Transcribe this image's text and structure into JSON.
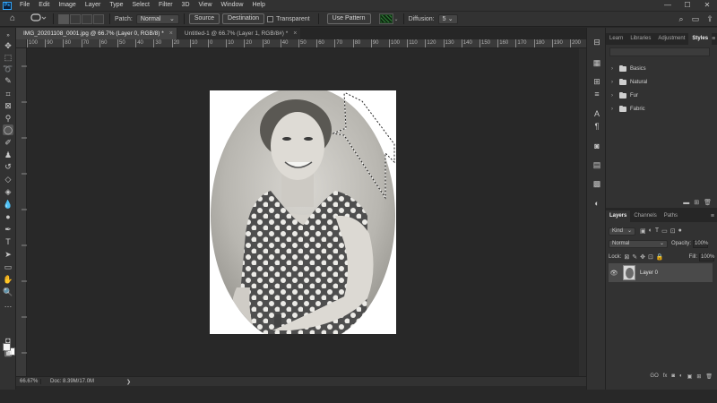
{
  "menu": {
    "app_icon": "Ps",
    "items": [
      "File",
      "Edit",
      "Image",
      "Layer",
      "Type",
      "Select",
      "Filter",
      "3D",
      "View",
      "Window",
      "Help"
    ],
    "window_controls": [
      "—",
      "☐",
      "✕"
    ]
  },
  "options_bar": {
    "patch_label": "Patch:",
    "patch_value": "Normal",
    "source_label": "Source",
    "destination_label": "Destination",
    "transparent_label": "Transparent",
    "transparent_checked": false,
    "use_pattern_label": "Use Pattern",
    "diffusion_label": "Diffusion:",
    "diffusion_value": "5"
  },
  "tabs": [
    {
      "title": "IMG_20201108_0001.jpg @ 66.7% (Layer 0, RGB/8) *",
      "active": true,
      "close": "×"
    },
    {
      "title": "Untitled-1 @ 66.7% (Layer 1, RGB/8#) *",
      "active": false,
      "close": "×"
    }
  ],
  "ruler": {
    "labels": [
      "100",
      "90",
      "80",
      "70",
      "60",
      "50",
      "40",
      "30",
      "20",
      "10",
      "0",
      "10",
      "20",
      "30",
      "40",
      "50",
      "60",
      "70",
      "80",
      "90",
      "100",
      "110",
      "120",
      "130",
      "140",
      "150",
      "160",
      "170",
      "180",
      "190",
      "200"
    ]
  },
  "status": {
    "zoom": "66.67%",
    "doc_info": "Doc: 8.39M/17.0M",
    "arrow": "❯"
  },
  "styles_panel": {
    "tabs": [
      "Learn",
      "Libraries",
      "Adjustment",
      "Styles"
    ],
    "active_tab": "Styles",
    "groups": [
      "Basics",
      "Natural",
      "Fur",
      "Fabric"
    ]
  },
  "layers_panel": {
    "tabs": [
      "Layers",
      "Channels",
      "Paths"
    ],
    "active_tab": "Layers",
    "filter_kind": "Kind",
    "blend_mode": "Normal",
    "opacity_label": "Opacity:",
    "opacity_value": "100%",
    "lock_label": "Lock:",
    "fill_label": "Fill:",
    "fill_value": "100%",
    "layers": [
      {
        "name": "Layer 0",
        "visible": true
      }
    ],
    "footer_icons": [
      "GO",
      "fx",
      "◙",
      "◐",
      "▣",
      "⊞",
      "🗑"
    ]
  },
  "colors": {
    "app_bg": "#323232",
    "canvas_bg": "#282828",
    "accent": "#31a8ff",
    "selected_layer": "#4a4a4a"
  },
  "icons": {
    "toolbar": [
      "move-icon",
      "marquee-icon",
      "lasso-icon",
      "quick-select-icon",
      "crop-icon",
      "frame-icon",
      "eyedropper-icon",
      "patch-tool-icon",
      "brush-icon",
      "clone-stamp-icon",
      "history-brush-icon",
      "eraser-icon",
      "gradient-icon",
      "blur-icon",
      "dodge-icon",
      "pen-icon",
      "type-icon",
      "path-select-icon",
      "rectangle-icon",
      "hand-icon",
      "zoom-icon",
      "more-tools-icon"
    ],
    "right_column": [
      "history-icon",
      "properties-icon",
      "adjustments-icon",
      "character-icon",
      "paragraph-icon",
      "camera-icon",
      "swatches-icon",
      "gradients-icon",
      "paths-icon"
    ]
  }
}
